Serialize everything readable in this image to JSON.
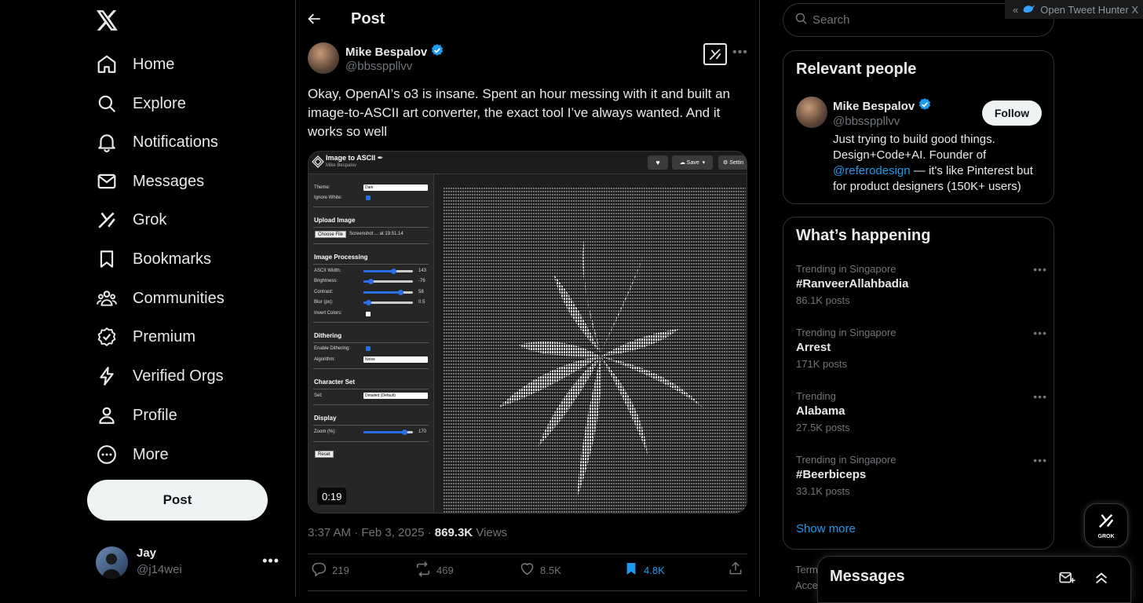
{
  "nav": {
    "items": [
      {
        "label": "Home",
        "icon": "home-icon"
      },
      {
        "label": "Explore",
        "icon": "search-icon"
      },
      {
        "label": "Notifications",
        "icon": "bell-icon"
      },
      {
        "label": "Messages",
        "icon": "envelope-icon"
      },
      {
        "label": "Grok",
        "icon": "grok-icon"
      },
      {
        "label": "Bookmarks",
        "icon": "bookmark-icon"
      },
      {
        "label": "Communities",
        "icon": "people-icon"
      },
      {
        "label": "Premium",
        "icon": "premium-icon"
      },
      {
        "label": "Verified Orgs",
        "icon": "lightning-icon"
      },
      {
        "label": "Profile",
        "icon": "person-icon"
      },
      {
        "label": "More",
        "icon": "more-circle-icon"
      }
    ],
    "post_label": "Post",
    "account": {
      "name": "Jay",
      "handle": "@j14wei"
    }
  },
  "main": {
    "title": "Post",
    "author": {
      "name": "Mike Bespalov",
      "handle": "@bbssppllvv"
    },
    "text": "Okay, OpenAI’s o3 is insane. Spent an hour messing with it and built an image-to-ASCII art converter, the exact tool I’ve always wanted. And it works so well",
    "media": {
      "app_title": "Image to ASCII ✒",
      "app_subtitle": "Mike Bespalov",
      "save_label": "Save",
      "settings_label": "Settin",
      "theme_label": "Theme:",
      "theme_value": "Dark",
      "ignore_white_label": "Ignore White:",
      "upload_heading": "Upload Image",
      "choose_file": "Choose File",
      "file_name": "Screenshot ... at 19.51.14",
      "processing_heading": "Image Processing",
      "sliders": [
        {
          "label": "ASCII Width:",
          "value": "143",
          "level": 0.6
        },
        {
          "label": "Brightness:",
          "value": "-76",
          "level": 0.15
        },
        {
          "label": "Contrast:",
          "value": "58",
          "level": 0.75
        },
        {
          "label": "Blur (px):",
          "value": "0.5",
          "level": 0.1
        }
      ],
      "invert_label": "Invert Colors:",
      "dither_heading": "Dithering",
      "enable_dither_label": "Enable Dithering:",
      "algorithm_label": "Algorithm:",
      "algorithm_value": "Noise",
      "charset_heading": "Character Set",
      "set_label": "Set:",
      "set_value": "Detailed (Default)",
      "display_heading": "Display",
      "zoom_label": "Zoom (%):",
      "zoom_value": "170",
      "zoom_level": 0.82,
      "reset_label": "Reset",
      "duration": "0:19"
    },
    "meta": {
      "time": "3:37 AM · Feb 3, 2025 ·",
      "views_count": "869.3K",
      "views_label": "Views"
    },
    "actions": {
      "replies": "219",
      "reposts": "469",
      "likes": "8.5K",
      "bookmarks": "4.8K"
    }
  },
  "right": {
    "search_placeholder": "Search",
    "relevant": {
      "title": "Relevant people",
      "name": "Mike Bespalov",
      "handle": "@bbssppllvv",
      "follow_label": "Follow",
      "bio_1": "Just trying to build good things. Design+Code+AI. Founder of ",
      "bio_link": "@referodesign",
      "bio_2": " — it's like Pinterest but for product designers (150K+ users)"
    },
    "happening": {
      "title": "What’s happening",
      "trends": [
        {
          "context": "Trending in Singapore",
          "topic": "#RanveerAllahbadia",
          "count": "86.1K posts"
        },
        {
          "context": "Trending in Singapore",
          "topic": "Arrest",
          "count": "171K posts"
        },
        {
          "context": "Trending",
          "topic": "Alabama",
          "count": "27.5K posts"
        },
        {
          "context": "Trending in Singapore",
          "topic": "#Beerbiceps",
          "count": "33.1K posts"
        }
      ],
      "show_more": "Show more"
    },
    "terms_1": "Term",
    "terms_2": "Acce"
  },
  "extension": {
    "label": "Open Tweet Hunter X",
    "chevron": "«"
  },
  "grok_float_label": "GROK",
  "messages_drawer": {
    "title": "Messages"
  }
}
